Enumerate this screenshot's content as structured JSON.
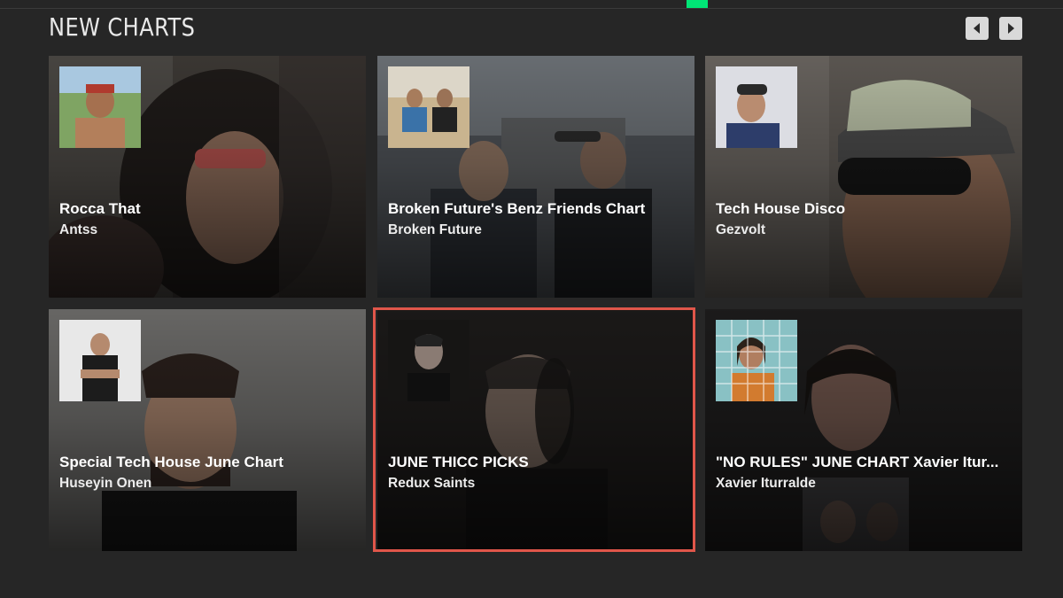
{
  "section": {
    "title": "NEW CHARTS"
  },
  "nav": {
    "prev_icon": "chevron-left-icon",
    "next_icon": "chevron-right-icon"
  },
  "colors": {
    "accent": "#00e676",
    "selection": "#e0564a",
    "background": "#262626"
  },
  "charts": [
    {
      "title": "Rocca That",
      "artist": "Antss"
    },
    {
      "title": "Broken Future's Benz Friends Chart",
      "artist": "Broken Future"
    },
    {
      "title": "Tech House Disco",
      "artist": "Gezvolt"
    },
    {
      "title": "Special Tech House June Chart",
      "artist": "Huseyin Onen"
    },
    {
      "title": "JUNE THICC PICKS",
      "artist": "Redux Saints",
      "selected": true
    },
    {
      "title": "\"NO RULES\" JUNE CHART Xavier Itur...",
      "artist": "Xavier Iturralde"
    }
  ]
}
